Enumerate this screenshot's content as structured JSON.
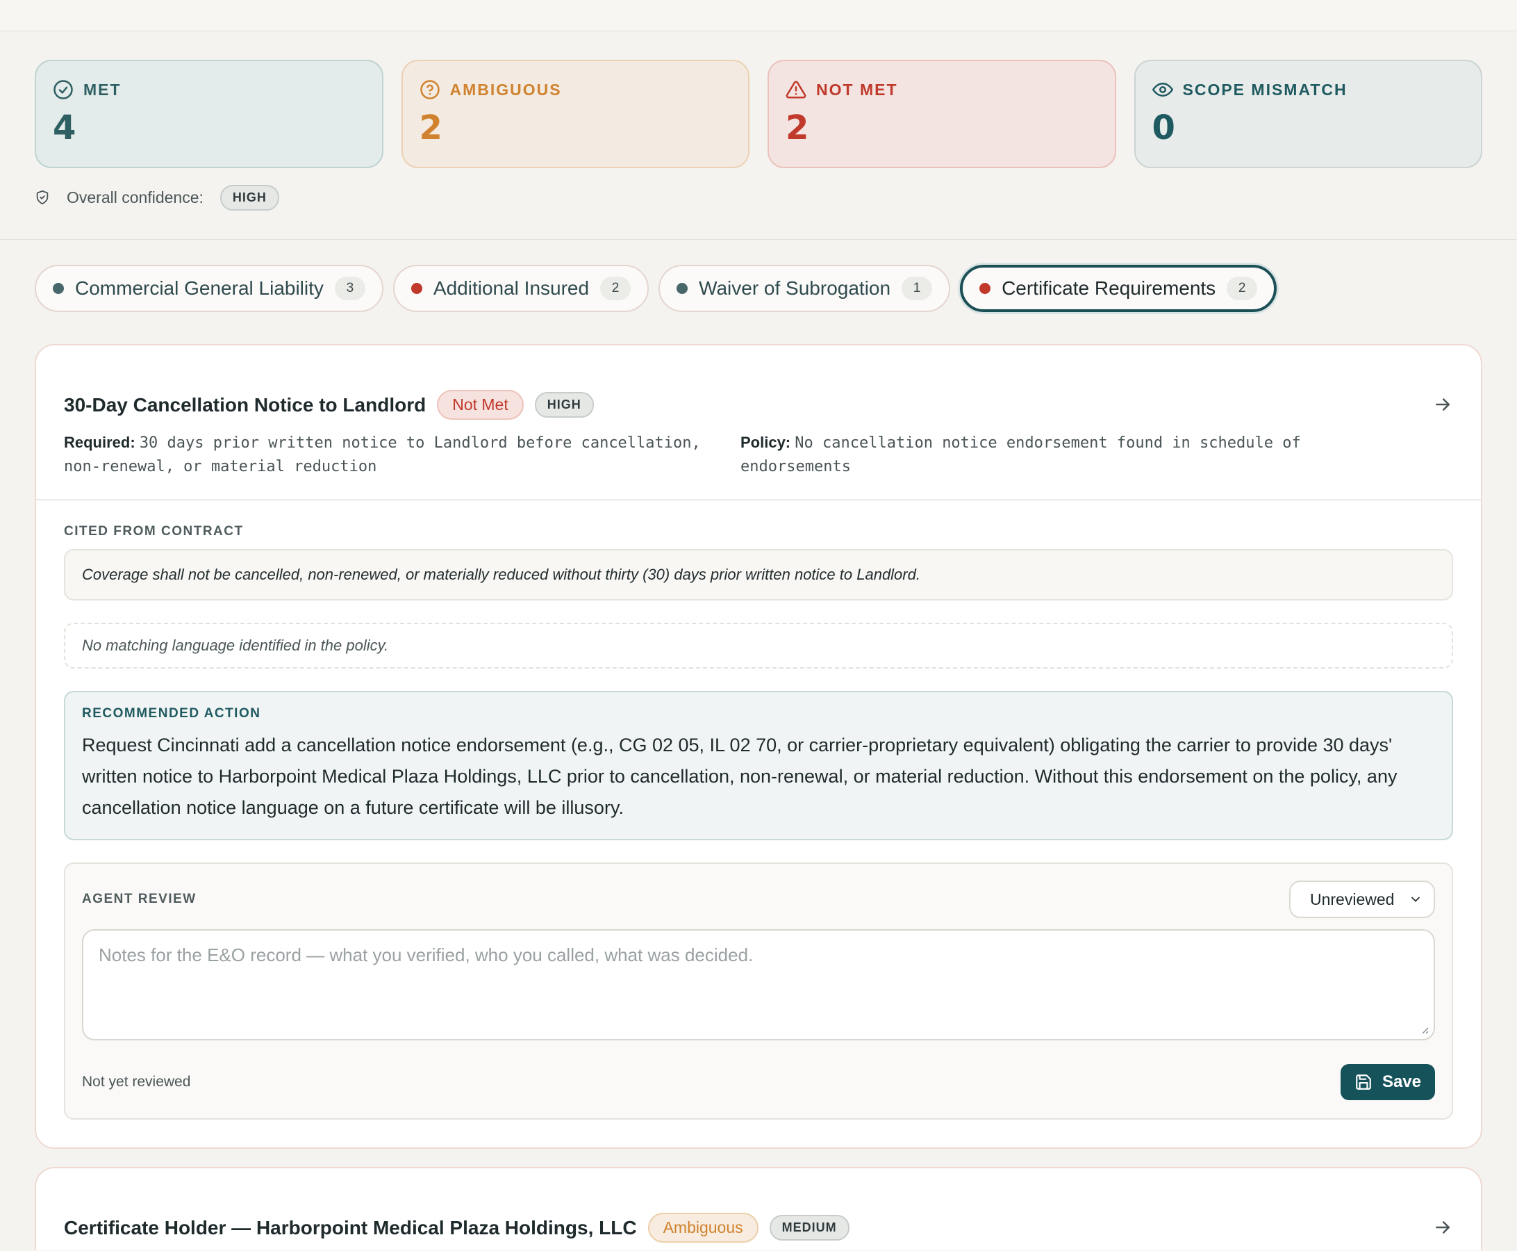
{
  "summary": {
    "met": {
      "label": "MET",
      "value": "4"
    },
    "ambiguous": {
      "label": "AMBIGUOUS",
      "value": "2"
    },
    "not_met": {
      "label": "NOT MET",
      "value": "2"
    },
    "scope_mismatch": {
      "label": "SCOPE MISMATCH",
      "value": "0"
    },
    "confidence_label": "Overall confidence:",
    "confidence_value": "HIGH"
  },
  "tabs": [
    {
      "label": "Commercial General Liability",
      "count": "3",
      "status": "teal"
    },
    {
      "label": "Additional Insured",
      "count": "2",
      "status": "red"
    },
    {
      "label": "Waiver of Subrogation",
      "count": "1",
      "status": "teal"
    },
    {
      "label": "Certificate Requirements",
      "count": "2",
      "status": "red",
      "active": true
    }
  ],
  "card1": {
    "title": "30-Day Cancellation Notice to Landlord",
    "status": "Not Met",
    "confidence": "HIGH",
    "required_label": "Required:",
    "required_text": "30 days prior written notice to Landlord before cancellation, non-renewal, or material reduction",
    "policy_label": "Policy:",
    "policy_text": "No cancellation notice endorsement found in schedule of endorsements",
    "cited_label": "CITED FROM CONTRACT",
    "cited_text": "Coverage shall not be cancelled, non-renewed, or materially reduced without thirty (30) days prior written notice to Landlord.",
    "no_match_text": "No matching language identified in the policy.",
    "rec_label": "RECOMMENDED ACTION",
    "rec_text": "Request Cincinnati add a cancellation notice endorsement (e.g., CG 02 05, IL 02 70, or carrier-proprietary equivalent) obligating the carrier to provide 30 days' written notice to Harborpoint Medical Plaza Holdings, LLC prior to cancellation, non-renewal, or material reduction. Without this endorsement on the policy, any cancellation notice language on a future certificate will be illusory.",
    "review_label": "AGENT REVIEW",
    "review_select": "Unreviewed",
    "notes_placeholder": "Notes for the E&O record — what you verified, who you called, what was decided.",
    "review_status": "Not yet reviewed",
    "save_label": "Save"
  },
  "card2": {
    "title": "Certificate Holder — Harborpoint Medical Plaza Holdings, LLC",
    "status": "Ambiguous",
    "confidence": "MEDIUM"
  },
  "colors": {
    "accent": "#16525a",
    "met": "#2e5f63",
    "ambiguous": "#d0822e",
    "not_met": "#c0392b"
  }
}
